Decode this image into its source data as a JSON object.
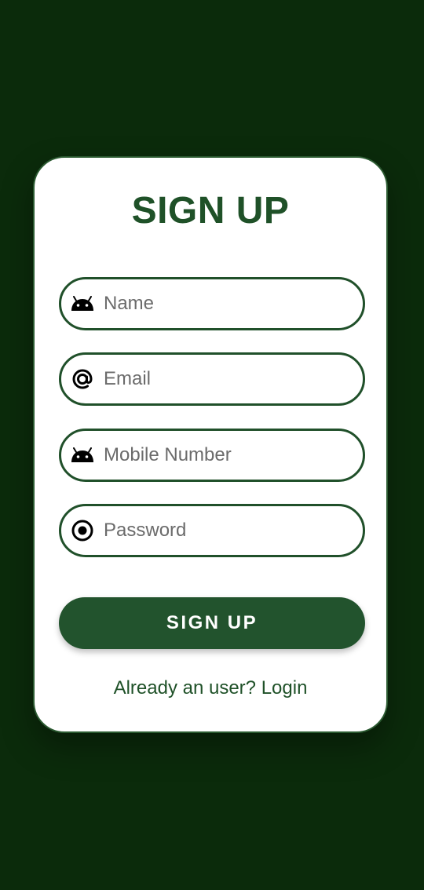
{
  "signup_form": {
    "title": "SIGN UP",
    "fields": {
      "name": {
        "placeholder": "Name",
        "value": ""
      },
      "email": {
        "placeholder": "Email",
        "value": ""
      },
      "mobile": {
        "placeholder": "Mobile Number",
        "value": ""
      },
      "password": {
        "placeholder": "Password",
        "value": ""
      }
    },
    "submit_label": "SIGN UP",
    "login_link": "Already an user? Login"
  },
  "icons": {
    "name": "android-icon",
    "email": "at-sign-icon",
    "mobile": "android-icon",
    "password": "radio-button-icon"
  },
  "colors": {
    "background": "#0b2b0b",
    "card": "#ffffff",
    "accent": "#22532d",
    "text_accent": "#1f5128"
  }
}
